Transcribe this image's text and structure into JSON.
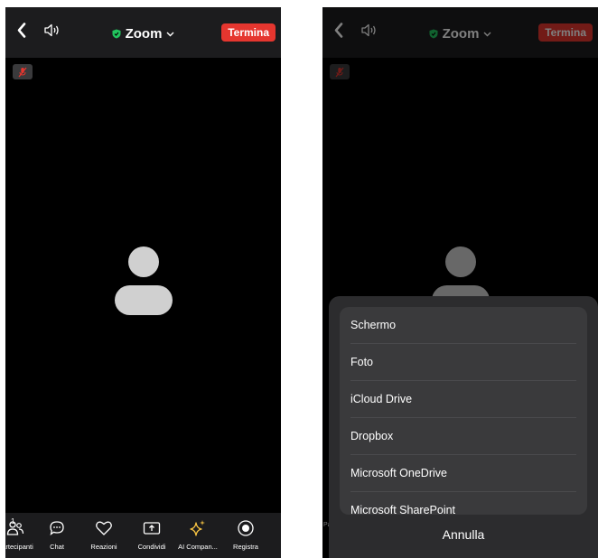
{
  "left_screen": {
    "meeting_title": "Zoom",
    "end_button": "Termina",
    "participants_count": "1",
    "toolbar": [
      {
        "label": "Partecipanti",
        "icon": "participants-icon"
      },
      {
        "label": "Chat",
        "icon": "chat-icon"
      },
      {
        "label": "Reazioni",
        "icon": "heart-icon"
      },
      {
        "label": "Condividi",
        "icon": "share-screen-icon"
      },
      {
        "label": "AI Compan...",
        "icon": "ai-sparkle-icon"
      },
      {
        "label": "Registra",
        "icon": "record-icon"
      }
    ],
    "colors": {
      "end_red": "#e5362f",
      "ai_yellow": "#f5c242",
      "shield_green": "#22c55e"
    }
  },
  "right_screen": {
    "meeting_title": "Zoom",
    "end_button": "Termina",
    "share_sheet": {
      "options": [
        "Schermo",
        "Foto",
        "iCloud Drive",
        "Dropbox",
        "Microsoft OneDrive",
        "Microsoft SharePoint"
      ],
      "cancel": "Annulla"
    }
  }
}
